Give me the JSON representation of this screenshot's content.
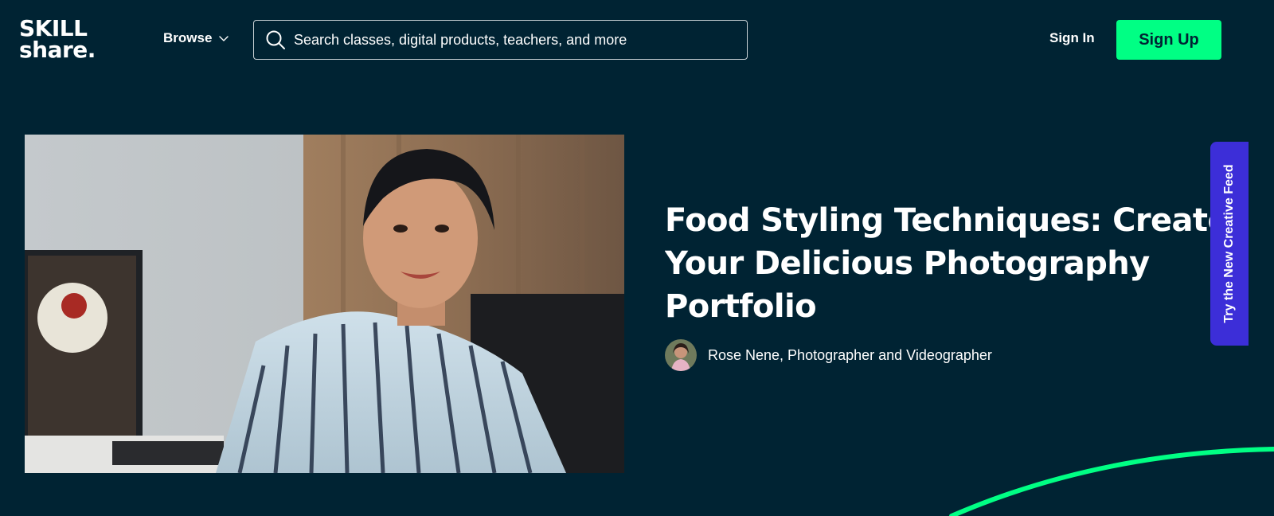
{
  "header": {
    "logo_line1": "SKILL",
    "logo_line2": "share.",
    "browse_label": "Browse",
    "search_placeholder": "Search classes, digital products, teachers, and more",
    "signin_label": "Sign In",
    "signup_label": "Sign Up"
  },
  "hero": {
    "title": "Food Styling Techniques: Create Your Delicious Photography Portfolio",
    "teacher": "Rose Nene, Photographer and Videographer"
  },
  "side_tab": {
    "label": "Try the New Creative Feed"
  },
  "colors": {
    "background": "#002333",
    "accent": "#00ff84",
    "tab": "#3c2ed8",
    "text": "#ffffff"
  },
  "icons": [
    "search-icon",
    "chevron-down-icon"
  ]
}
